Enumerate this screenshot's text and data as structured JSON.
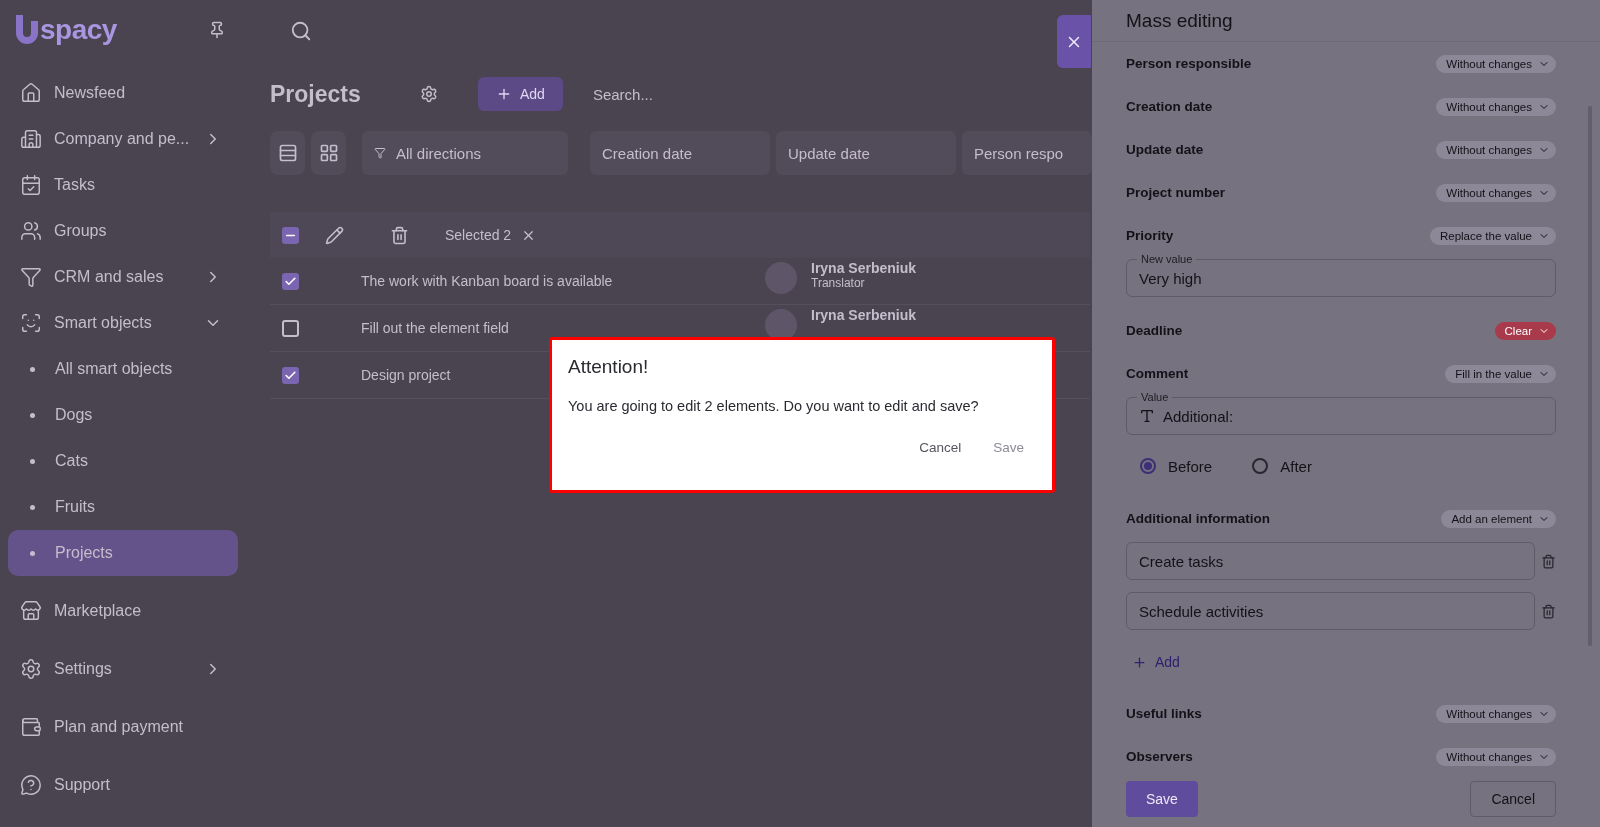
{
  "logo": {
    "text": "spacy"
  },
  "sidebar": {
    "items": [
      {
        "kind": "link",
        "label": "Newsfeed",
        "selected": false
      },
      {
        "kind": "submenu",
        "label": "Company and pe...",
        "selected": false
      },
      {
        "kind": "link",
        "label": "Tasks",
        "selected": false
      },
      {
        "kind": "link",
        "label": "Groups",
        "selected": false
      },
      {
        "kind": "submenu",
        "label": "CRM and sales",
        "selected": false
      },
      {
        "kind": "group",
        "label": "Smart objects",
        "selected": false,
        "children": [
          {
            "label": "All smart objects",
            "selected": false
          },
          {
            "label": "Dogs",
            "selected": false
          },
          {
            "label": "Cats",
            "selected": false
          },
          {
            "label": "Fruits",
            "selected": false
          },
          {
            "label": "Projects",
            "selected": true
          }
        ]
      },
      {
        "kind": "link",
        "label": "Marketplace",
        "selected": false
      },
      {
        "kind": "submenu",
        "label": "Settings",
        "selected": false
      },
      {
        "kind": "link",
        "label": "Plan and payment",
        "selected": false
      },
      {
        "kind": "link",
        "label": "Support",
        "selected": false
      }
    ]
  },
  "page": {
    "title": "Projects",
    "add_button": "Add",
    "search": {
      "placeholder": "Search..."
    },
    "filters": [
      {
        "label": "All directions",
        "kind": "direction"
      },
      {
        "label": "Creation date",
        "kind": "date"
      },
      {
        "label": "Update date",
        "kind": "date"
      },
      {
        "label": "Person respo",
        "kind": "cut"
      }
    ],
    "selection": {
      "label": "Selected 2",
      "indeterminate": true
    },
    "rows": [
      {
        "name": "The work with Kanban board is available",
        "checked": true,
        "person": "Iryna Serbeniuk",
        "role": "Translator"
      },
      {
        "name": "Fill out the element field",
        "checked": false,
        "person": "Iryna Serbeniuk"
      },
      {
        "name": "Design project",
        "checked": true
      }
    ]
  },
  "panel": {
    "title": "Mass editing",
    "fields": [
      {
        "kind": "select",
        "label": "Person responsible",
        "mode": "Without changes",
        "alert": false
      },
      {
        "kind": "select",
        "label": "Creation date",
        "mode": "Without changes",
        "alert": false
      },
      {
        "kind": "select",
        "label": "Update date",
        "mode": "Without changes",
        "alert": false
      },
      {
        "kind": "select",
        "label": "Project number",
        "mode": "Without changes",
        "alert": false
      },
      {
        "kind": "value",
        "label": "Priority",
        "mode": "Replace the value",
        "alert": false,
        "field_label": "New value",
        "value": "Very high"
      },
      {
        "kind": "select",
        "label": "Deadline",
        "mode": "Clear",
        "alert": true
      },
      {
        "kind": "text",
        "label": "Comment",
        "mode": "Fill in the value",
        "alert": false,
        "field_label": "Value",
        "value": "Additional:",
        "options": [
          {
            "label": "Before",
            "selected": true
          },
          {
            "label": "After",
            "selected": false
          }
        ]
      },
      {
        "kind": "list",
        "label": "Additional information",
        "mode": "Add an element",
        "alert": false,
        "items": [
          "Create tasks",
          "Schedule activities"
        ],
        "add_label": "Add"
      },
      {
        "kind": "select",
        "label": "Useful links",
        "mode": "Without changes",
        "alert": false
      },
      {
        "kind": "select",
        "label": "Observers",
        "mode": "Without changes",
        "alert": false
      }
    ],
    "save": "Save",
    "cancel": "Cancel"
  },
  "dialog": {
    "title": "Attention!",
    "message": "You are going to edit 2 elements. Do you want to edit and save?",
    "buttons": [
      {
        "label": "Cancel",
        "disabled": false
      },
      {
        "label": "Save",
        "disabled": true
      }
    ]
  }
}
